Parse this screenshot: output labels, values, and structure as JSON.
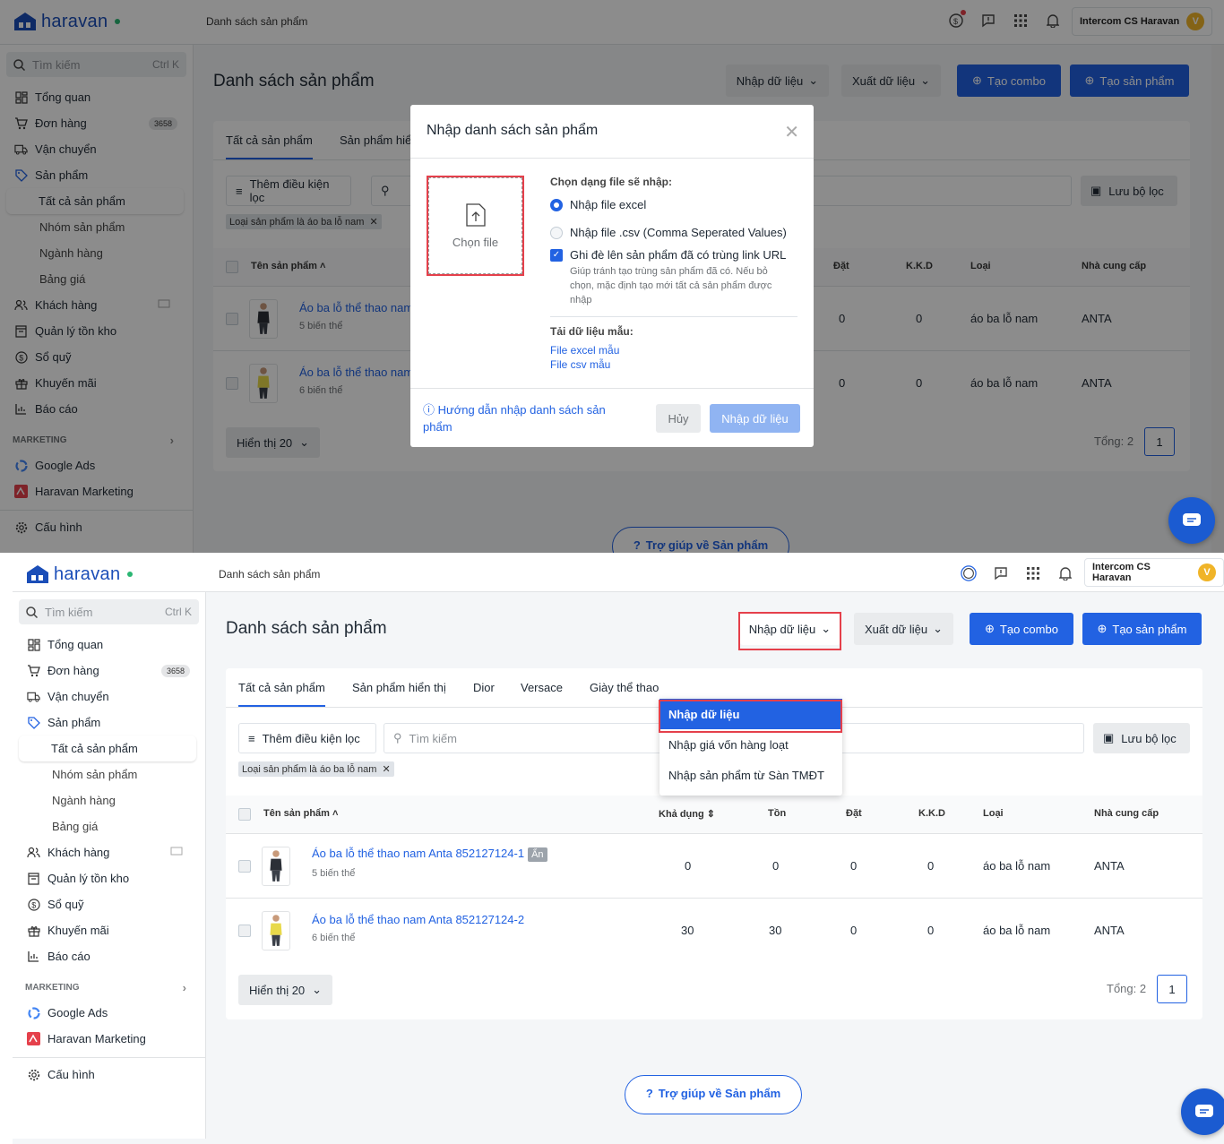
{
  "top": {
    "brand": "haravan",
    "page": "Danh sách sản phẩm",
    "user": "Intercom CS Haravan",
    "avatar": "V"
  },
  "sidebar": {
    "search_placeholder": "Tìm kiếm",
    "search_shortcut": "Ctrl K",
    "items": [
      {
        "label": "Tổng quan"
      },
      {
        "label": "Đơn hàng",
        "badge": "3658"
      },
      {
        "label": "Vận chuyển"
      },
      {
        "label": "Sản phẩm"
      },
      {
        "label": "Tất cả sản phẩm"
      },
      {
        "label": "Nhóm sản phẩm"
      },
      {
        "label": "Ngành hàng"
      },
      {
        "label": "Bảng giá"
      },
      {
        "label": "Khách hàng"
      },
      {
        "label": "Quản lý tồn kho"
      },
      {
        "label": "Sổ quỹ"
      },
      {
        "label": "Khuyến mãi"
      },
      {
        "label": "Báo cáo"
      }
    ],
    "marketing_label": "MARKETING",
    "marketing": [
      {
        "label": "Google Ads"
      },
      {
        "label": "Haravan Marketing"
      }
    ],
    "settings": "Cấu hình"
  },
  "header": {
    "title": "Danh sách sản phẩm",
    "import": "Nhập dữ liệu",
    "export": "Xuất dữ liệu",
    "create_combo": "Tạo combo",
    "create_product": "Tạo sản phẩm"
  },
  "tabs": [
    "Tất cả sản phẩm",
    "Sản phẩm hiển thị",
    "Dior",
    "Versace",
    "Giày thể thao"
  ],
  "tab_clipped_s1": "Sản phẩm hiể",
  "tab_clipped_s2": "Giày thể thao",
  "filter": {
    "add": "Thêm điều kiện lọc",
    "search_placeholder": "Tìm kiếm",
    "save": "Lưu bộ lọc",
    "chip": "Loại sản phẩm là áo ba lỗ nam"
  },
  "columns": {
    "name": "Tên sản phẩm",
    "available": "Khả dụng",
    "stock": "Tồn",
    "ordered": "Đặt",
    "kkd": "K.K.D",
    "type": "Loại",
    "vendor": "Nhà cung cấp"
  },
  "rows": [
    {
      "name": "Áo ba lỗ thể thao nam Anta 852127124-1",
      "name_short": "Áo ba lỗ thể thao nam",
      "variants": "5 biến thể",
      "hidden": "Ẩn",
      "available": "0",
      "stock": "0",
      "ordered": "0",
      "kkd": "0",
      "type": "áo ba lỗ nam",
      "vendor": "ANTA",
      "shirt_color": "#2b2f36"
    },
    {
      "name": "Áo ba lỗ thể thao nam Anta 852127124-2",
      "name_short": "Áo ba lỗ thể thao nam",
      "variants": "6 biến thể",
      "available": "30",
      "stock": "30",
      "ordered": "0",
      "kkd": "0",
      "type": "áo ba lỗ nam",
      "vendor": "ANTA",
      "shirt_color": "#e8d94a"
    }
  ],
  "pager": {
    "show": "Hiển thị 20",
    "total": "Tổng: 2",
    "page": "1"
  },
  "help": "Trợ giúp về Sản phẩm",
  "modal": {
    "title": "Nhập danh sách sản phẩm",
    "choose_file": "Chọn file",
    "format_label": "Chọn dạng file sẽ nhập:",
    "opt_excel": "Nhập file excel",
    "opt_csv": "Nhập file .csv (Comma Seperated Values)",
    "overwrite": "Ghi đè lên sản phẩm đã có trùng link URL",
    "overwrite_hint": "Giúp tránh tạo trùng sản phẩm đã có. Nếu bỏ chọn, mặc định tạo mới tất cả sản phẩm được nhập",
    "sample_label": "Tải dữ liệu mẫu:",
    "sample_excel": "File excel mẫu",
    "sample_csv": "File csv mẫu",
    "guide": "Hướng dẫn nhập danh sách sản phẩm",
    "cancel": "Hủy",
    "submit": "Nhập dữ liệu"
  },
  "dropdown": [
    "Nhập dữ liệu",
    "Nhập giá vốn hàng loạt",
    "Nhập sản phẩm từ Sàn TMĐT"
  ],
  "colors": {
    "accent": "#2262e2",
    "highlight": "#e5404b"
  }
}
